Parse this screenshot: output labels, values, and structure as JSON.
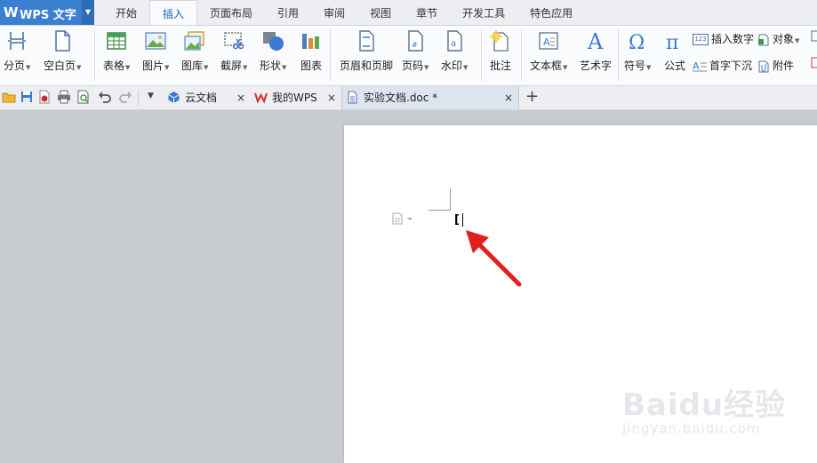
{
  "app": {
    "logo": "W",
    "title": "WPS 文字"
  },
  "menu_tabs": [
    "开始",
    "插入",
    "页面布局",
    "引用",
    "审阅",
    "视图",
    "章节",
    "开发工具",
    "特色应用"
  ],
  "ribbon": {
    "page_break": "分页",
    "blank_page": "空白页",
    "table": "表格",
    "picture": "图片",
    "gallery": "图库",
    "screenshot": "截屏",
    "shape": "形状",
    "chart": "图表",
    "header_footer": "页眉和页脚",
    "page_number": "页码",
    "watermark": "水印",
    "comment": "批注",
    "textbox": "文本框",
    "wordart": "艺术字",
    "symbol": "符号",
    "formula": "公式",
    "insert_number": "插入数字",
    "object": "对象",
    "drop_cap": "首字下沉",
    "attachment": "附件",
    "insert_number_icon_text": "123"
  },
  "doc_tabs": {
    "cloud": "云文档",
    "mywps": "我的WPS",
    "current": "实验文档.doc *",
    "close": "×",
    "new": "+"
  },
  "document": {
    "bracket": "["
  },
  "watermark": {
    "brand": "Baidu经验",
    "url": "jingyan.baidu.com"
  },
  "colors": {
    "app_blue": "#3b7fd0",
    "active_tab_text": "#1f5fb8",
    "arrow": "#e02020"
  }
}
